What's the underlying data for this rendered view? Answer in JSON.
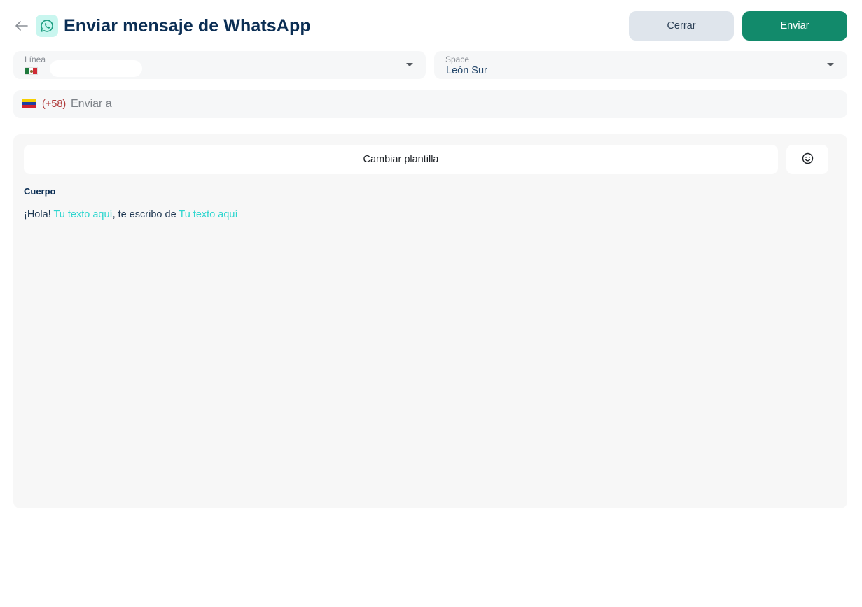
{
  "header": {
    "title": "Enviar mensaje de WhatsApp",
    "close_label": "Cerrar",
    "send_label": "Enviar"
  },
  "line_field": {
    "label": "Línea",
    "flag": "mexico-flag-icon"
  },
  "space_field": {
    "label": "Space",
    "value": "León Sur"
  },
  "phone_field": {
    "flag": "venezuela-flag-icon",
    "dial_code": "(+58)",
    "placeholder": "Enviar a"
  },
  "template": {
    "change_label": "Cambiar plantilla",
    "emoji_icon": "smiley-icon",
    "body_title": "Cuerpo",
    "body_parts": [
      "¡Hola! ",
      "Tu texto aquí",
      ", te escribo de ",
      "Tu texto aquí"
    ]
  },
  "colors": {
    "primary": "#128a6b",
    "variable_text": "#2fd6cf",
    "title": "#0b2e54",
    "field_bg": "#f6f7f8"
  }
}
